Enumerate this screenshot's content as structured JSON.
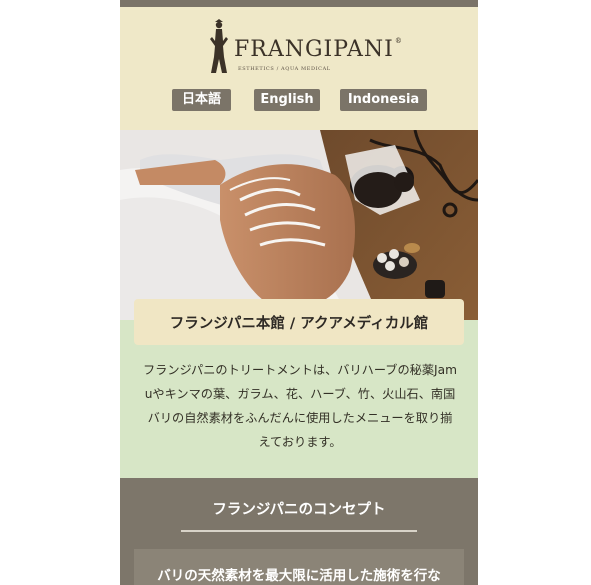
{
  "header": {
    "brand": "FRANGIPANI",
    "brand_mark": "®",
    "brand_sub": "ESTHETICS / AQUA MEDICAL"
  },
  "languages": [
    {
      "label": "日本語"
    },
    {
      "label": "English"
    },
    {
      "label": "Indonesia"
    }
  ],
  "intro": {
    "title": "フランジパニ本館 / アクアメディカル館",
    "text": "フランジパニのトリートメントは、バリハーブの秘薬Jamuやキンマの葉、ガラム、花、ハーブ、竹、火山石、南国バリの自然素材をふんだんに使用したメニューを取り揃えております。"
  },
  "concept": {
    "title": "フランジパニのコンセプト",
    "card_text": "バリの天然素材を最大限に活用した施術を行な"
  },
  "colors": {
    "header_bg": "#efe8c8",
    "lang_button_bg": "#7b7468",
    "intro_bg": "#d7e6c6",
    "title_box_bg": "#f0e6c4",
    "concept_bg": "#7d766a"
  }
}
